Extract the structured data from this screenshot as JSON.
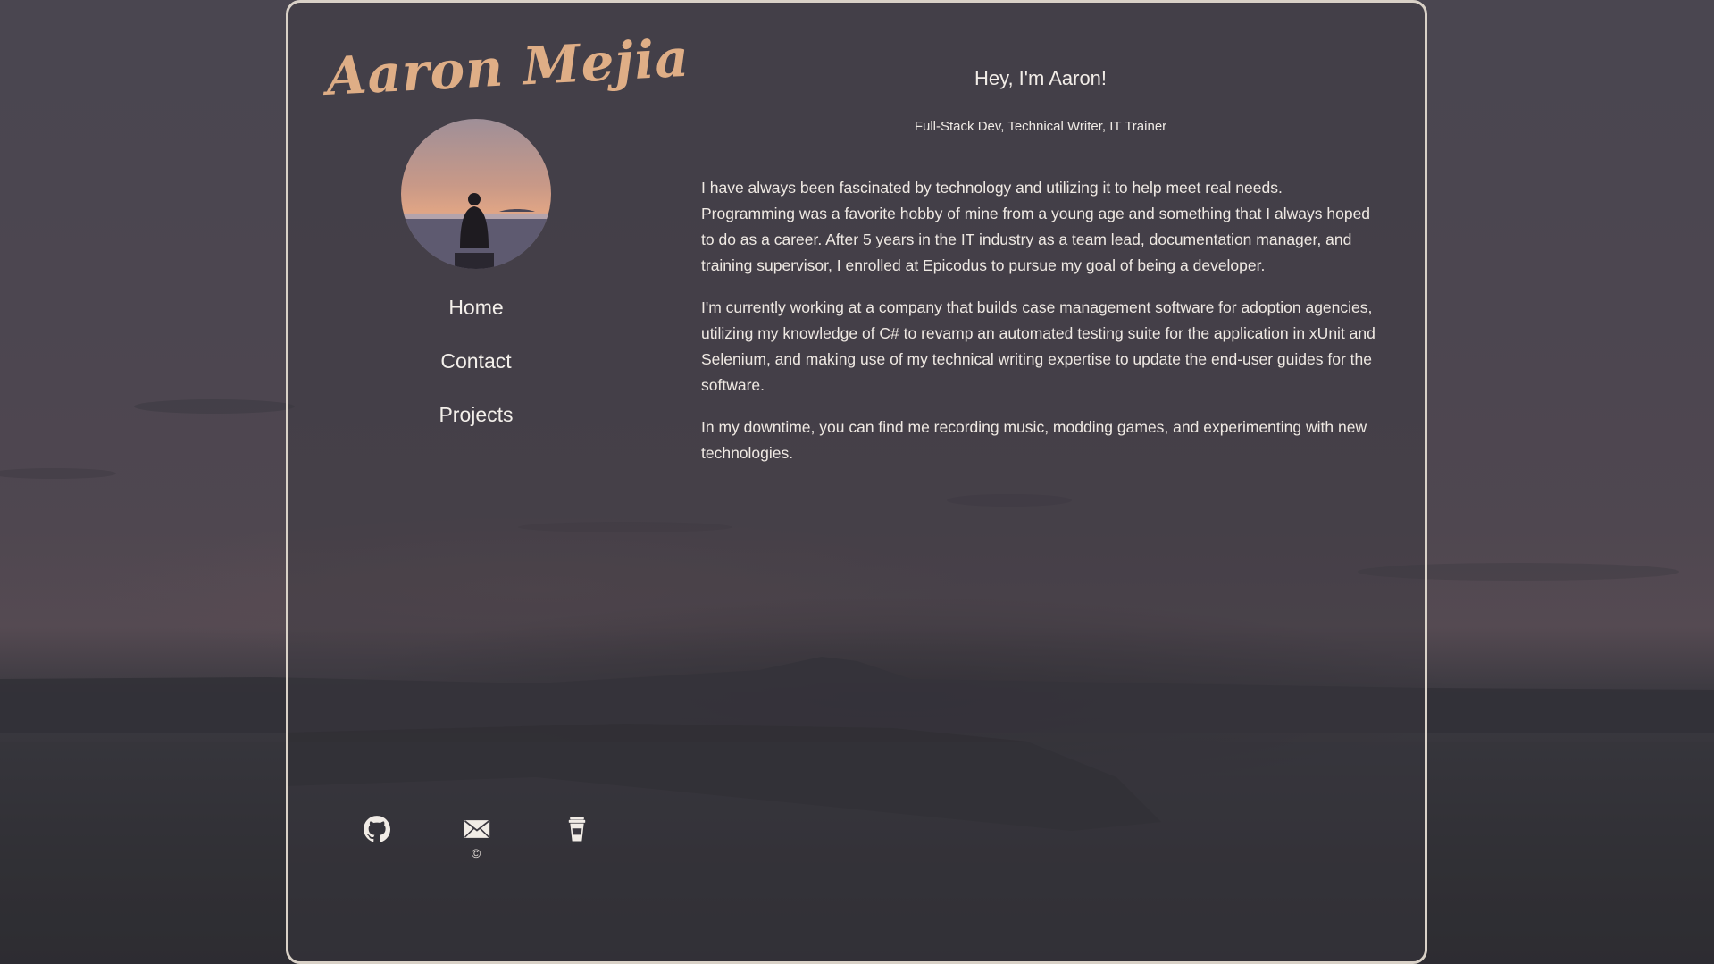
{
  "site": {
    "logo_text": "Aaron Mejia"
  },
  "nav": {
    "items": [
      {
        "label": "Home"
      },
      {
        "label": "Contact"
      },
      {
        "label": "Projects"
      }
    ]
  },
  "main": {
    "greeting": "Hey, I'm Aaron!",
    "subtitle": "Full-Stack Dev, Technical Writer, IT Trainer",
    "paragraphs": [
      "I have always been fascinated by technology and utilizing it to help meet real needs. Programming was a favorite hobby of mine from a young age and something that I always hoped to do as a career. After 5 years in the IT industry as a team lead, documentation manager, and training supervisor, I enrolled at Epicodus to pursue my goal of being a developer.",
      "I'm currently working at a company that builds case management software for adoption agencies, utilizing my knowledge of C# to revamp an automated testing suite for the application in xUnit and Selenium, and making use of my technical writing expertise to update the end-user guides for the software.",
      "In my downtime, you can find me recording music, modding games, and experimenting with new technologies."
    ]
  },
  "footer": {
    "icons": [
      "github-icon",
      "mail-icon",
      "coffee-cup-icon"
    ],
    "copyright": "©"
  },
  "colors": {
    "accent": "#dfae86",
    "card_border": "#d9d1c7",
    "text": "#efe9e3"
  }
}
